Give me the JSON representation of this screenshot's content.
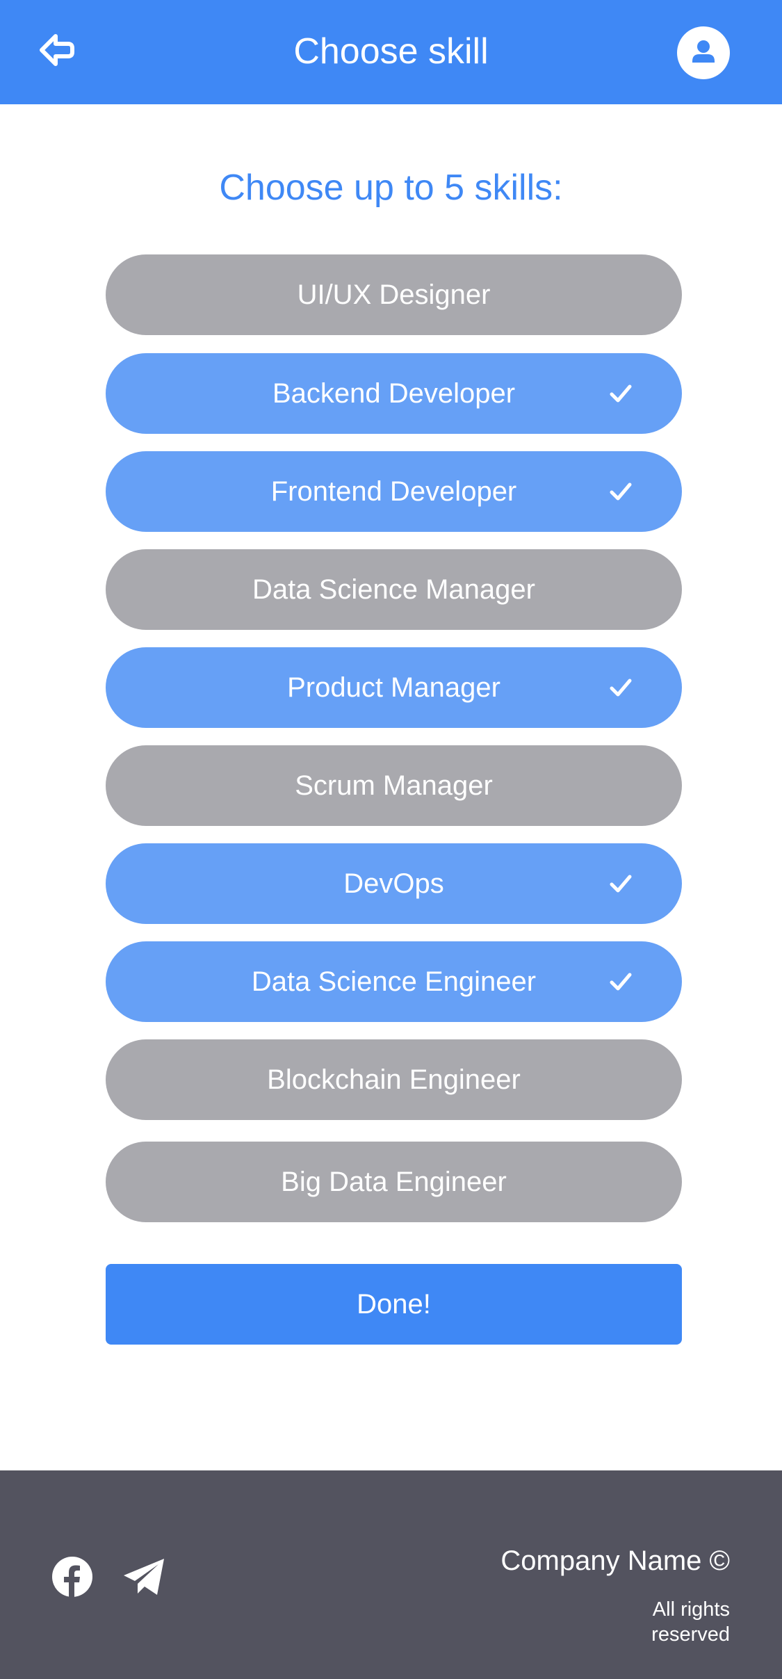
{
  "header": {
    "title": "Choose skill",
    "back_icon": "back-arrow-icon",
    "profile_icon": "user-icon"
  },
  "main": {
    "prompt": "Choose up to 5 skills:",
    "skills": [
      {
        "label": "UI/UX Designer",
        "selected": false
      },
      {
        "label": "Backend Developer",
        "selected": true
      },
      {
        "label": "Frontend Developer",
        "selected": true
      },
      {
        "label": "Data Science Manager",
        "selected": false
      },
      {
        "label": "Product Manager",
        "selected": true
      },
      {
        "label": "Scrum Manager",
        "selected": false
      },
      {
        "label": "DevOps",
        "selected": true
      },
      {
        "label": "Data Science Engineer",
        "selected": true
      },
      {
        "label": "Blockchain Engineer",
        "selected": false
      },
      {
        "label": "Big Data Engineer",
        "selected": false
      }
    ],
    "done_label": "Done!"
  },
  "footer": {
    "social_icons": [
      "facebook-icon",
      "telegram-icon"
    ],
    "company": "Company Name ©",
    "rights": "All rights reserved"
  },
  "colors": {
    "primary": "#3f88f5",
    "selected": "#66a0f6",
    "unselected": "#a9a9ae",
    "footer": "#53535f"
  }
}
